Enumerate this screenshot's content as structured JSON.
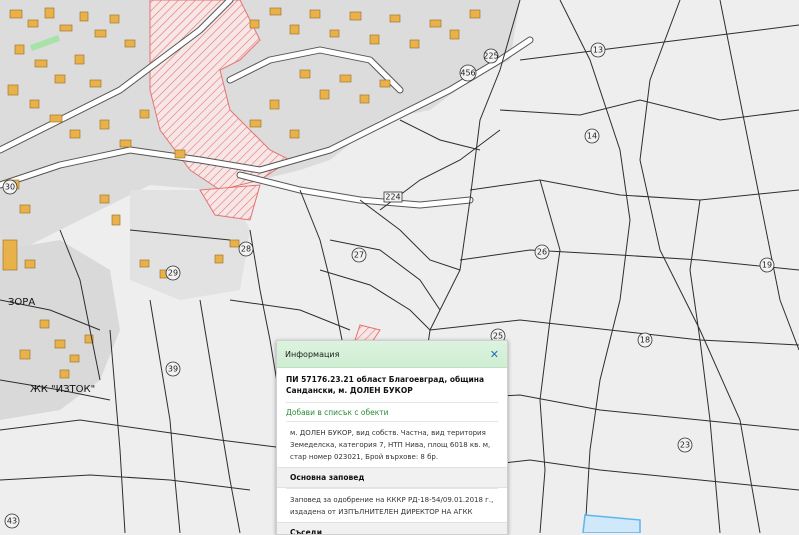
{
  "map": {
    "plot_numbers": [
      "13",
      "14",
      "18",
      "19",
      "23",
      "25",
      "26",
      "27",
      "28",
      "29",
      "30",
      "39",
      "43",
      "224",
      "225",
      "456"
    ],
    "districts": {
      "zora": "ЗОРА",
      "iztok": "ЖК \"ИЗТОК\""
    }
  },
  "popup": {
    "title": "Информация",
    "close_icon": "close-icon",
    "heading": "ПИ 57176.23.21 област Благоевград, община Сандански, м. ДОЛЕН БУКОР",
    "add_link": "Добави в списък с обекти",
    "details": "м. ДОЛЕН БУКОР, вид собств. Частна, вид територия Земеделска, категория 7, НТП Нива, площ 6018 кв. м, стар номер 023021, Брой върхове: 8 бр.",
    "order_title": "Основна заповед",
    "order_text": "Заповед за одобрение на КККР РД-18-54/09.01.2018 г., издадена от ИЗПЪЛНИТЕЛЕН ДИРЕКТОР НА АГКК",
    "neighbors_title": "Съседи"
  },
  "colors": {
    "building": "#e9b14a",
    "hatch": "#e57373",
    "road": "#ffffff",
    "parcel_line": "#2e2e2e",
    "highlight": "#5bb6f0",
    "popup_header": "#d5f0d8"
  }
}
